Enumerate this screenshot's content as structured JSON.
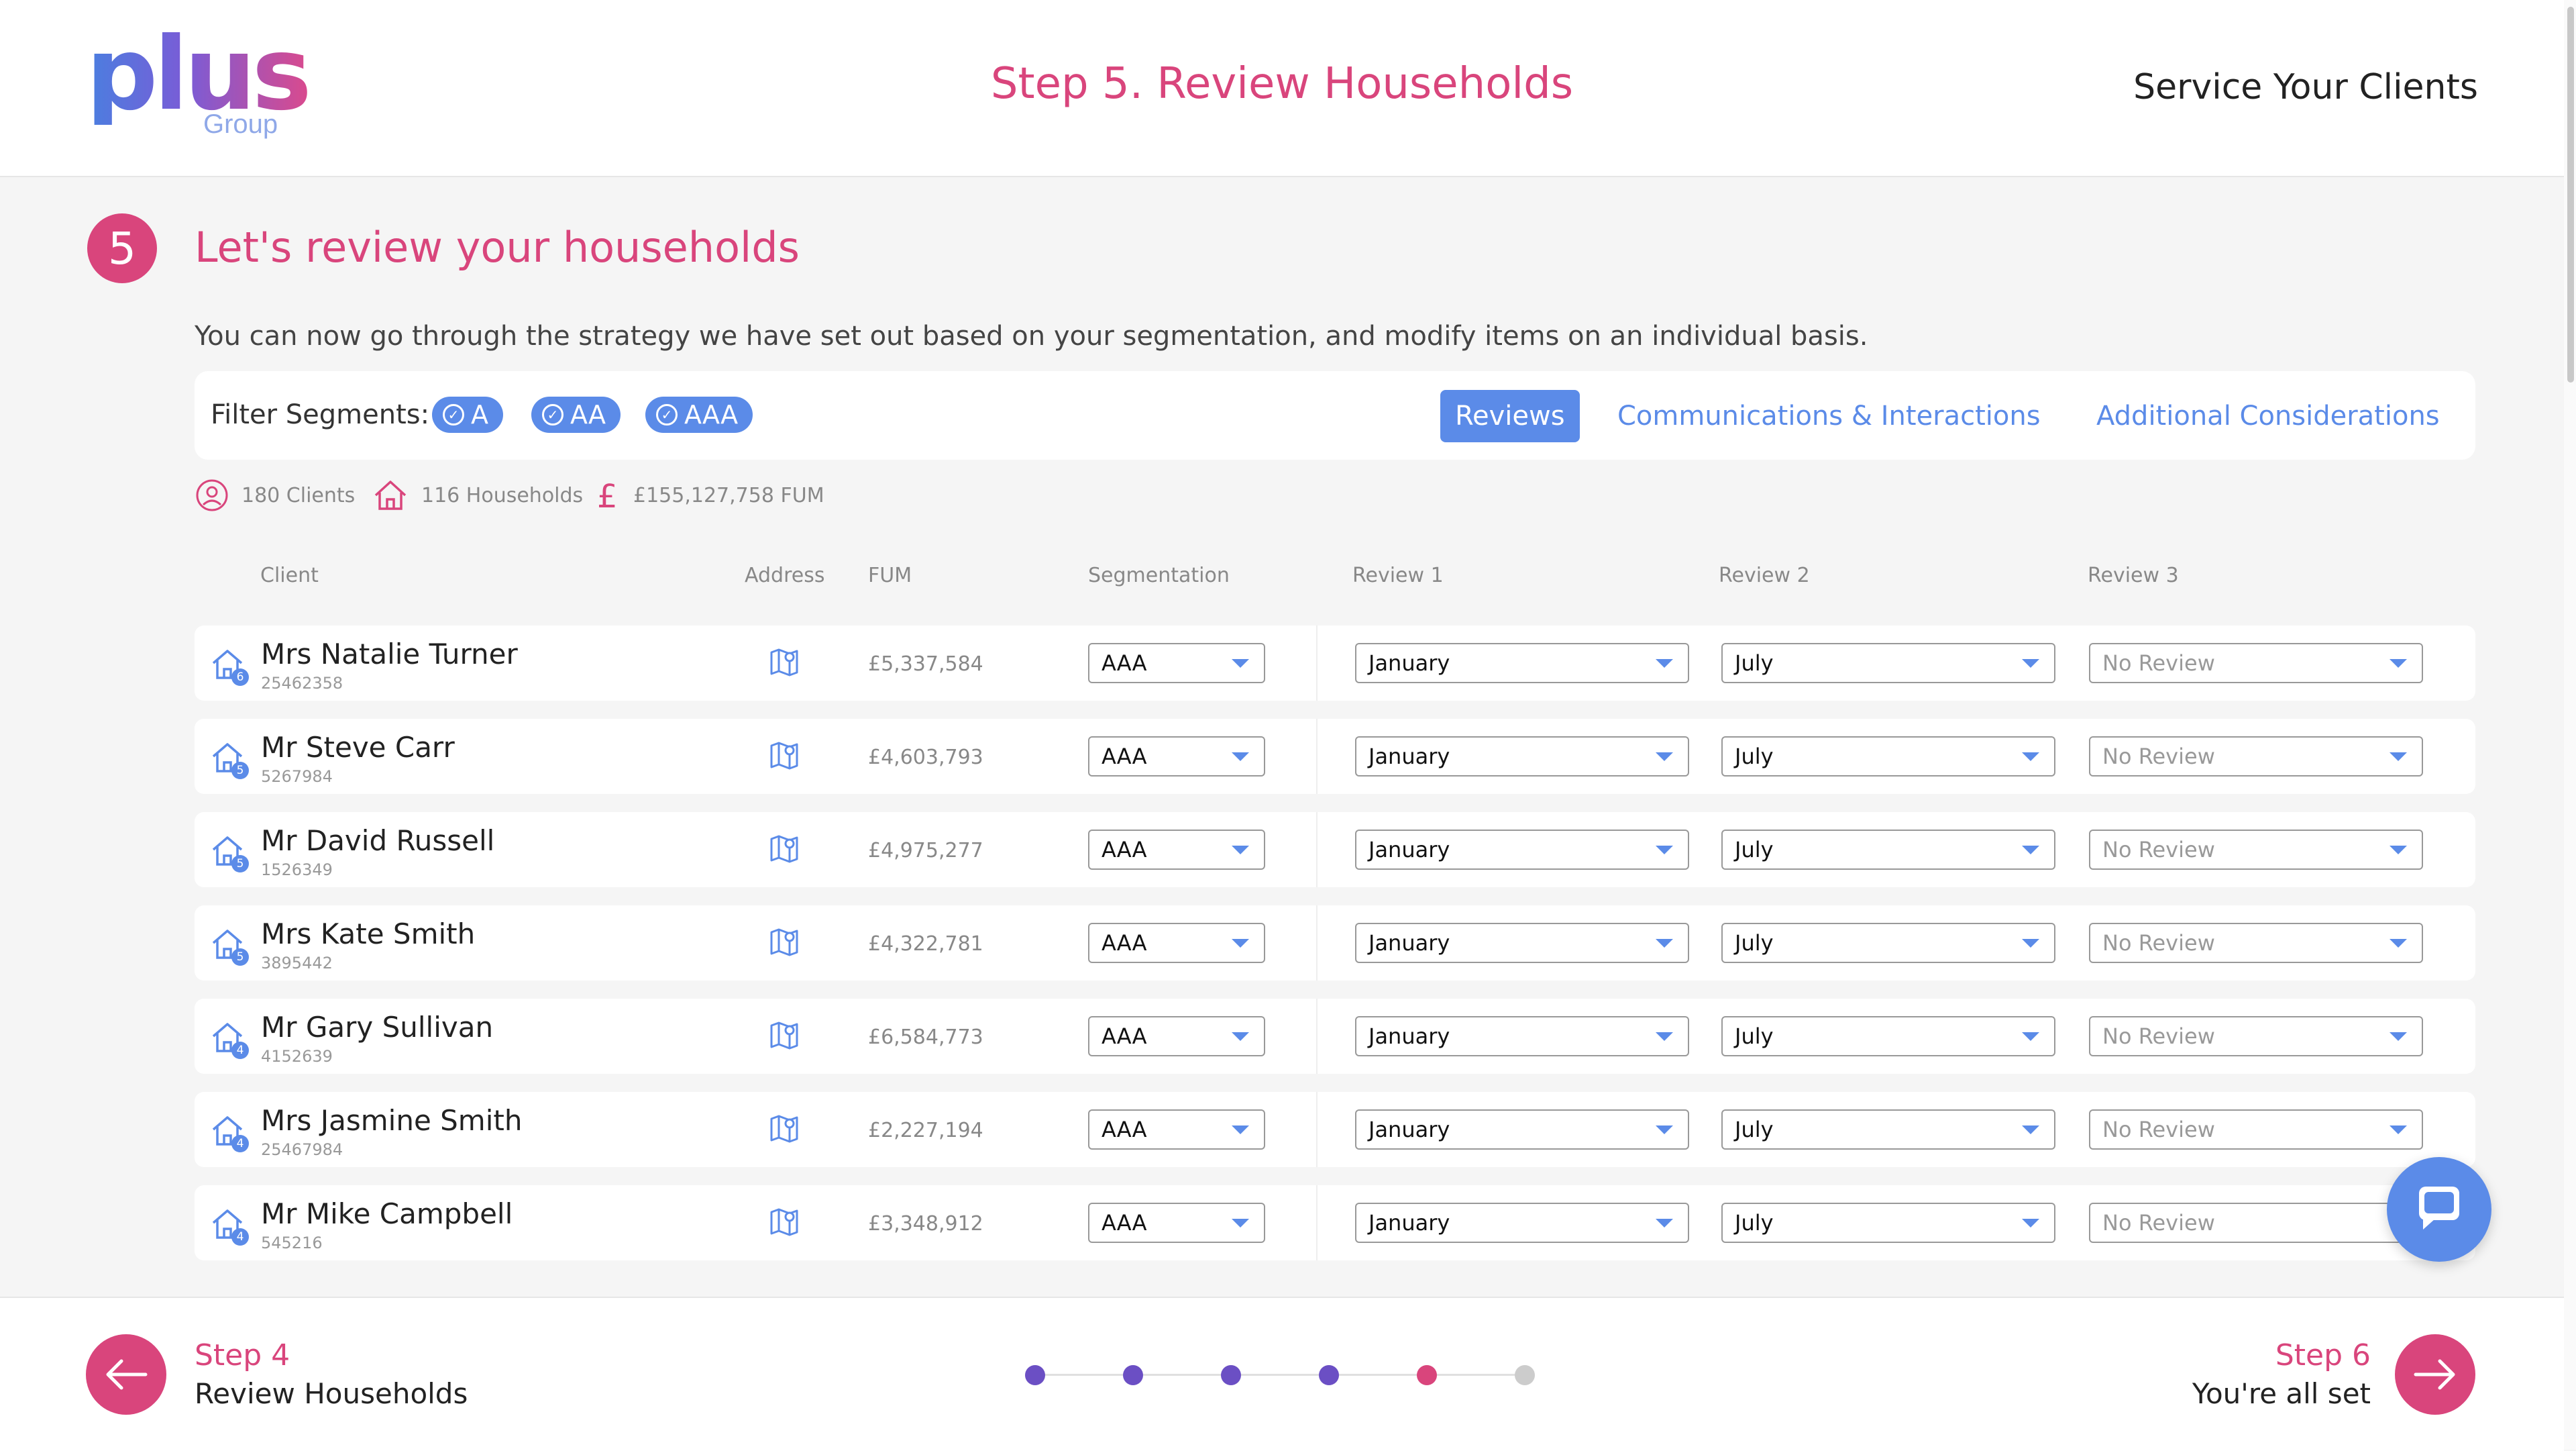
{
  "header": {
    "logo_text": "plus",
    "logo_sub": "Group",
    "step_title": "Step 5. Review Households",
    "service_link": "Service Your Clients"
  },
  "section": {
    "number": "5",
    "title": "Let's review your households",
    "intro": "You can now go through the strategy we have set out based on your segmentation, and modify items on an individual basis."
  },
  "filters": {
    "label": "Filter Segments:",
    "chips": [
      "A",
      "AA",
      "AAA"
    ],
    "tabs": [
      "Reviews",
      "Communications & Interactions",
      "Additional Considerations"
    ],
    "active_tab": "Reviews"
  },
  "stats": {
    "clients": "180 Clients",
    "households": "116 Households",
    "fum": "£155,127,758 FUM"
  },
  "columns": [
    "Client",
    "Address",
    "FUM",
    "Segmentation",
    "Review 1",
    "Review 2",
    "Review 3"
  ],
  "rows": [
    {
      "name": "Mrs Natalie Turner",
      "id": "25462358",
      "household_size": "6",
      "fum": "£5,337,584",
      "segmentation": "AAA",
      "review1": "January",
      "review2": "July",
      "review3": "No Review"
    },
    {
      "name": "Mr Steve Carr",
      "id": "5267984",
      "household_size": "5",
      "fum": "£4,603,793",
      "segmentation": "AAA",
      "review1": "January",
      "review2": "July",
      "review3": "No Review"
    },
    {
      "name": "Mr David Russell",
      "id": "1526349",
      "household_size": "5",
      "fum": "£4,975,277",
      "segmentation": "AAA",
      "review1": "January",
      "review2": "July",
      "review3": "No Review"
    },
    {
      "name": "Mrs Kate Smith",
      "id": "3895442",
      "household_size": "5",
      "fum": "£4,322,781",
      "segmentation": "AAA",
      "review1": "January",
      "review2": "July",
      "review3": "No Review"
    },
    {
      "name": "Mr Gary Sullivan",
      "id": "4152639",
      "household_size": "4",
      "fum": "£6,584,773",
      "segmentation": "AAA",
      "review1": "January",
      "review2": "July",
      "review3": "No Review"
    },
    {
      "name": "Mrs Jasmine Smith",
      "id": "25467984",
      "household_size": "4",
      "fum": "£2,227,194",
      "segmentation": "AAA",
      "review1": "January",
      "review2": "July",
      "review3": "No Review"
    },
    {
      "name": "Mr Mike Campbell",
      "id": "545216",
      "household_size": "4",
      "fum": "£3,348,912",
      "segmentation": "AAA",
      "review1": "January",
      "review2": "July",
      "review3": "No Review"
    }
  ],
  "footer": {
    "prev_step": "Step 4",
    "prev_label": "Review Households",
    "next_step": "Step 6",
    "next_label": "You're all set",
    "progress_steps": 6,
    "current_step": 5
  },
  "colors": {
    "accent_pink": "#d9457c",
    "accent_blue": "#5b8be8",
    "dot_done": "#6b4fc4",
    "dot_current": "#d9457c",
    "dot_pending": "#cccccc"
  }
}
